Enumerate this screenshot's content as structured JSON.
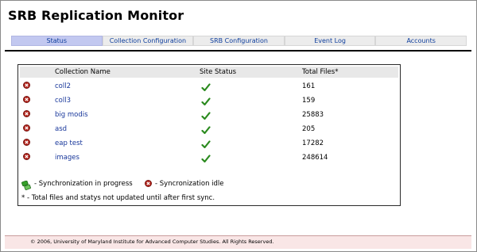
{
  "app": {
    "title": "SRB Replication Monitor"
  },
  "tabs": [
    {
      "label": "Status",
      "active": true
    },
    {
      "label": "Collection Configuration",
      "active": false
    },
    {
      "label": "SRB Configuration",
      "active": false
    },
    {
      "label": "Event Log",
      "active": false
    },
    {
      "label": "Accounts",
      "active": false
    }
  ],
  "table": {
    "headers": {
      "collection": "Collection Name",
      "site_status": "Site Status",
      "total_files": "Total Files*"
    },
    "rows": [
      {
        "icon": "sync-idle-icon",
        "collection": "coll2",
        "site_status": "check-icon",
        "total_files": "161"
      },
      {
        "icon": "sync-idle-icon",
        "collection": "coll3",
        "site_status": "check-icon",
        "total_files": "159"
      },
      {
        "icon": "sync-idle-icon",
        "collection": "big modis",
        "site_status": "check-icon",
        "total_files": "25883"
      },
      {
        "icon": "sync-idle-icon",
        "collection": "asd",
        "site_status": "check-icon",
        "total_files": "205"
      },
      {
        "icon": "sync-idle-icon",
        "collection": "eap test",
        "site_status": "check-icon",
        "total_files": "17282"
      },
      {
        "icon": "sync-idle-icon",
        "collection": "images",
        "site_status": "check-icon",
        "total_files": "248614"
      }
    ]
  },
  "legend": {
    "in_progress": "- Synchronization in progress",
    "idle": "- Syncronization idle",
    "note": "* - Total files and statys not updated until after first sync."
  },
  "footer": {
    "text": "© 2006, University of Maryland Institute for Advanced Computer Studies. All Rights Reserved."
  },
  "colors": {
    "active_tab": "#c2c8f0",
    "tab": "#ececec",
    "link": "#17369a",
    "idle_red": "#b3261e",
    "check_green": "#2a8a1e",
    "footer_bg": "#f9e6e6"
  }
}
